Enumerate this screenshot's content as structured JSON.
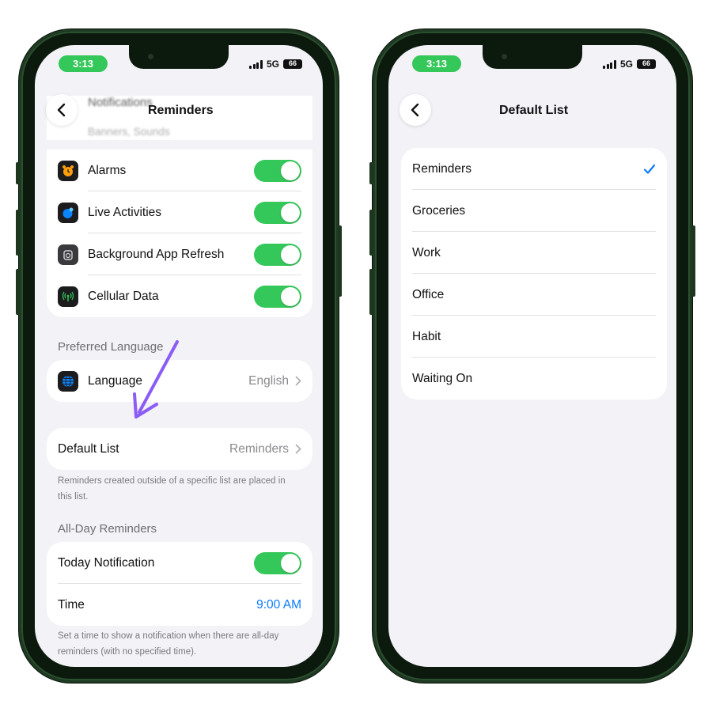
{
  "status": {
    "time": "3:13",
    "network": "5G",
    "battery": "66"
  },
  "left_screen": {
    "title": "Reminders",
    "partial_row": {
      "label": "Notifications",
      "sub": "Banners, Sounds"
    },
    "permissions": [
      {
        "label": "Alarms",
        "icon": "alarm-clock-icon",
        "on": true
      },
      {
        "label": "Live Activities",
        "icon": "live-activities-icon",
        "on": true
      },
      {
        "label": "Background App Refresh",
        "icon": "background-refresh-icon",
        "on": true
      },
      {
        "label": "Cellular Data",
        "icon": "cellular-antenna-icon",
        "on": true
      }
    ],
    "preferred_language_header": "Preferred Language",
    "language": {
      "label": "Language",
      "value": "English",
      "icon": "globe-icon"
    },
    "default_list": {
      "label": "Default List",
      "value": "Reminders"
    },
    "default_list_footer": "Reminders created outside of a specific list are placed in this list.",
    "all_day_header": "All-Day Reminders",
    "today_notification": {
      "label": "Today Notification",
      "on": true
    },
    "time_row": {
      "label": "Time",
      "value": "9:00 AM"
    },
    "time_footer": "Set a time to show a notification when there are all-day reminders (with no specified time)."
  },
  "right_screen": {
    "title": "Default List",
    "lists": [
      {
        "label": "Reminders",
        "selected": true
      },
      {
        "label": "Groceries",
        "selected": false
      },
      {
        "label": "Work",
        "selected": false
      },
      {
        "label": "Office",
        "selected": false
      },
      {
        "label": "Habit",
        "selected": false
      },
      {
        "label": "Waiting On",
        "selected": false
      }
    ]
  },
  "colors": {
    "toggle_on": "#34c759",
    "accent_blue": "#0a7aff",
    "annotation_arrow": "#8b5cf6",
    "phone_frame": "#1f3a22"
  }
}
